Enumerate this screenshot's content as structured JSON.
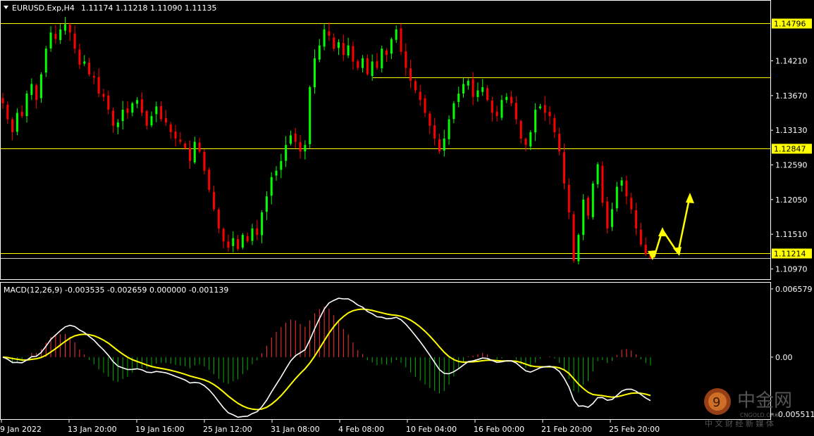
{
  "header": {
    "symbol": "EURUSD.Exp,H4",
    "ohlc": "1.11174 1.11218 1.11090 1.11135"
  },
  "macd_header": "MACD(12,26,9) -0.003535 -0.002659 0.000000 -0.001139",
  "colors": {
    "background": "#000000",
    "frame": "#ffffff",
    "bull": "#00ff00",
    "bear": "#ff0000",
    "level": "#ffff00",
    "macd_line": "#ffffff",
    "signal_line": "#ffff00",
    "hist_pos": "#ff3333",
    "hist_neg": "#00b000"
  },
  "chart_data": [
    {
      "type": "candlestick",
      "title": "EURUSD.Exp,H4",
      "ylim": [
        1.107,
        1.1505
      ],
      "price_ticks": [
        "1.14210",
        "1.13670",
        "1.13130",
        "1.12590",
        "1.12050",
        "1.11510",
        "1.10970"
      ],
      "time_ticks": [
        "9 Jan 2022",
        "13 Jan 20:00",
        "19 Jan 16:00",
        "25 Jan 12:00",
        "31 Jan 08:00",
        "4 Feb 08:00",
        "10 Feb 04:00",
        "16 Feb 00:00",
        "21 Feb 20:00",
        "25 Feb 20:00"
      ],
      "levels": [
        {
          "value": 1.14796,
          "label": "1.14796",
          "tagged": true
        },
        {
          "value": 1.1395,
          "label": "",
          "tagged": false
        },
        {
          "value": 1.12847,
          "label": "1.12847",
          "tagged": true
        },
        {
          "value": 1.11214,
          "label": "1.11214",
          "tagged": true
        },
        {
          "value": 1.11135,
          "label": "1.11135",
          "tagged": false
        }
      ],
      "close_path": [
        1.1355,
        1.133,
        1.131,
        1.134,
        1.1335,
        1.137,
        1.1385,
        1.136,
        1.14,
        1.144,
        1.1465,
        1.1455,
        1.147,
        1.1478,
        1.1465,
        1.144,
        1.1415,
        1.142,
        1.14,
        1.1395,
        1.137,
        1.1365,
        1.1345,
        1.132,
        1.1325,
        1.1345,
        1.134,
        1.1355,
        1.136,
        1.134,
        1.132,
        1.1335,
        1.135,
        1.133,
        1.1325,
        1.131,
        1.13,
        1.1295,
        1.1285,
        1.1265,
        1.1295,
        1.128,
        1.125,
        1.122,
        1.119,
        1.116,
        1.114,
        1.113,
        1.1145,
        1.1128,
        1.115,
        1.114,
        1.116,
        1.115,
        1.1185,
        1.121,
        1.124,
        1.125,
        1.1265,
        1.129,
        1.1305,
        1.1295,
        1.128,
        1.129,
        1.138,
        1.1425,
        1.1445,
        1.147,
        1.146,
        1.144,
        1.145,
        1.143,
        1.1445,
        1.142,
        1.141,
        1.1425,
        1.14,
        1.142,
        1.141,
        1.144,
        1.143,
        1.1455,
        1.147,
        1.1435,
        1.141,
        1.139,
        1.1375,
        1.136,
        1.134,
        1.132,
        1.13,
        1.128,
        1.13,
        1.133,
        1.1355,
        1.137,
        1.1385,
        1.139,
        1.1365,
        1.1375,
        1.138,
        1.136,
        1.134,
        1.1335,
        1.136,
        1.1365,
        1.1355,
        1.133,
        1.13,
        1.129,
        1.131,
        1.1345,
        1.135,
        1.134,
        1.1335,
        1.131,
        1.128,
        1.123,
        1.1185,
        1.111,
        1.115,
        1.1205,
        1.118,
        1.123,
        1.126,
        1.12,
        1.116,
        1.119,
        1.1225,
        1.1235,
        1.121,
        1.119,
        1.116,
        1.1135,
        1.112,
        1.1114
      ]
    },
    {
      "type": "bar",
      "title": "MACD(12,26,9)",
      "values_text": "-0.003535 -0.002659 0.000000 -0.001139",
      "ylim": [
        -0.00551,
        0.00657
      ],
      "ticks": [
        "0.006579",
        "0.00",
        "-0.005511"
      ]
    }
  ],
  "watermark": {
    "brand": "中金网",
    "brand_en": "CNGOLD.ORG",
    "slogan": "中 文 财 经 新 媒 体"
  }
}
